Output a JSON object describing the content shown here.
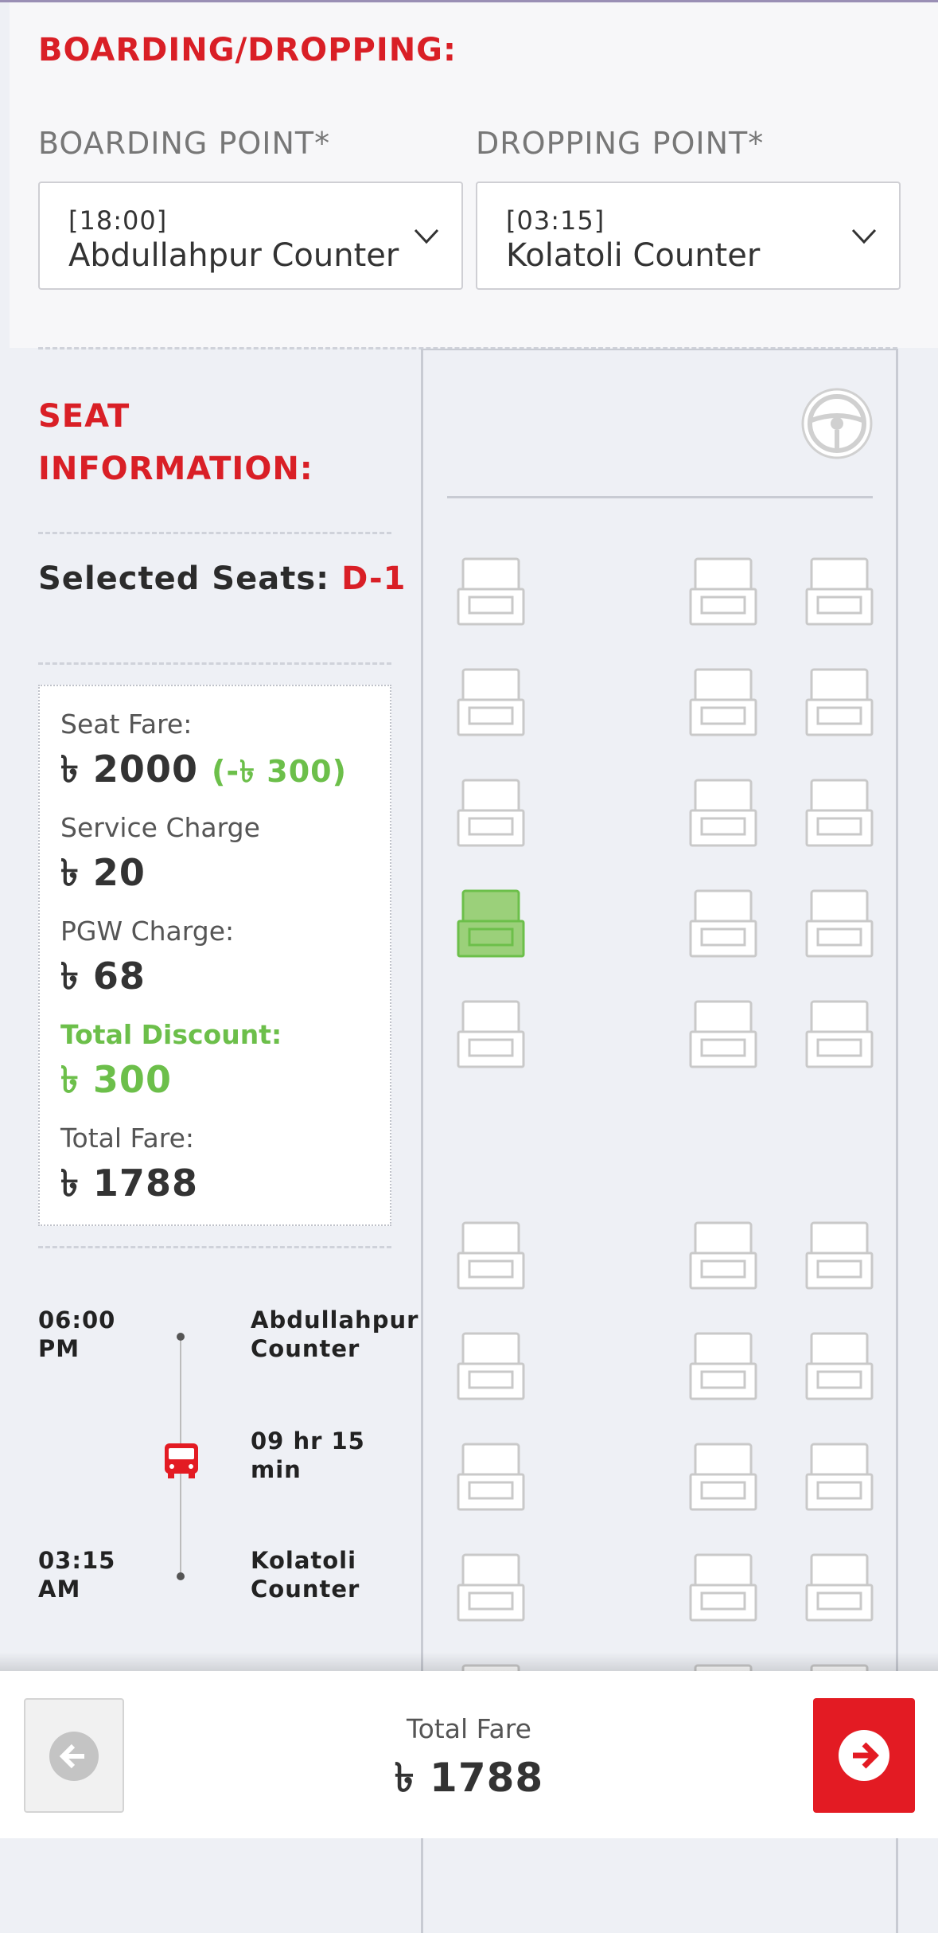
{
  "boarding": {
    "section_title": "BOARDING/DROPPING:",
    "boarding_label": "BOARDING POINT*",
    "boarding_time": "[18:00]",
    "boarding_value": "Abdullahpur Counter",
    "dropping_label": "DROPPING POINT*",
    "dropping_time": "[03:15]",
    "dropping_value": "Kolatoli Counter"
  },
  "seat_info": {
    "title_line1": "SEAT",
    "title_line2": "INFORMATION:",
    "selected_label": "Selected Seats:",
    "selected_value": "D-1"
  },
  "fare": {
    "seat_fare_label": "Seat Fare:",
    "seat_fare_value": "৳ 2000",
    "seat_fare_discount": "(-৳ 300)",
    "service_label": "Service Charge",
    "service_value": "৳ 20",
    "pgw_label": "PGW Charge:",
    "pgw_value": "৳ 68",
    "discount_label": "Total Discount:",
    "discount_value": "৳ 300",
    "total_label": "Total Fare:",
    "total_value": "৳ 1788"
  },
  "timeline": {
    "depart_time_1": "06:00",
    "depart_time_2": "PM",
    "depart_place_1": "Abdullahpur",
    "depart_place_2": "Counter",
    "duration_1": "09 hr 15",
    "duration_2": "min",
    "arrive_time_1": "03:15",
    "arrive_time_2": "AM",
    "arrive_place_1": "Kolatoli",
    "arrive_place_2": "Counter"
  },
  "seat_map": {
    "selected_seat": "D-1",
    "selected_color": "#9bd07a",
    "available_color": "#ffffff"
  },
  "footer": {
    "total_label": "Total Fare",
    "total_value": "৳ 1788"
  },
  "colors": {
    "accent_red": "#d91f26",
    "discount_green": "#6cbf4a"
  }
}
